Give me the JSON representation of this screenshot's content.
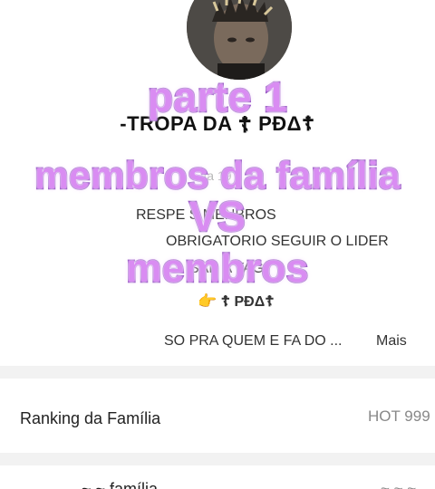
{
  "family": {
    "name_prefix": "-TROPA DA",
    "name_mark": "☦",
    "name_suffix": "PÐΔ☦",
    "faint_text": "fa         19"
  },
  "description": {
    "line1": "RESPE          S MENBROS",
    "line2": "OBRIGATORIO SEGUIR O LIDER",
    "line3": "                   SAR A TAG",
    "line4_hand": "👉",
    "line4_mark": "☦",
    "line4_text": "PÐΔ☦",
    "line5": "SO PRA QUEM E FA DO ...",
    "more": "Mais"
  },
  "ranking": {
    "label": "Ranking da Família",
    "value": "HOT 999"
  },
  "next_row": {
    "label": "...  ~ ~ família",
    "value": "~ ~ ~"
  },
  "overlay": {
    "line1": "parte 1",
    "line2": "membros da família",
    "line3": "VS",
    "line4": "membros"
  },
  "colors": {
    "overlay_fill": "#d98cf2",
    "overlay_stroke": "#7b2bb3",
    "band": "#f2f2f2",
    "muted": "#888888"
  },
  "icons": {
    "avatar": "user-avatar-photo",
    "hand": "pointing-hand-icon",
    "cross": "orthodox-cross-icon"
  }
}
